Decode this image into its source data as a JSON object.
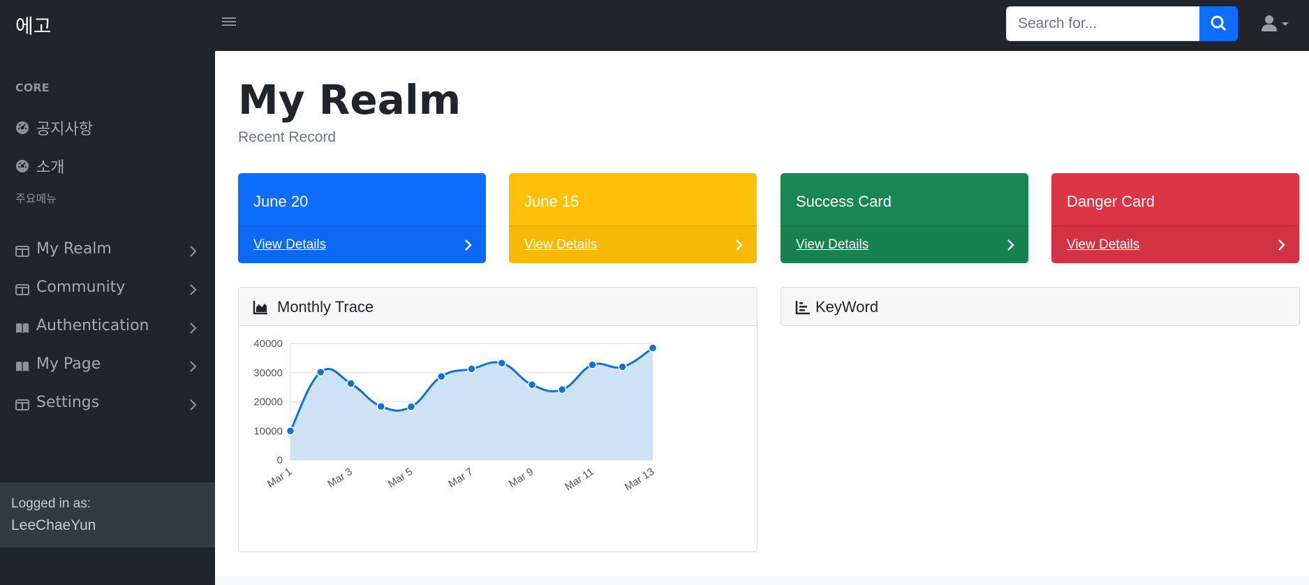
{
  "topnav": {
    "brand": "에고",
    "search_placeholder": "Search for...",
    "icons": {
      "menu": "hamburger-icon",
      "search": "search-icon",
      "user": "user-icon"
    }
  },
  "sidebar": {
    "heading_core": "CORE",
    "core_items": [
      {
        "label": "공지사항",
        "icon": "dashboard-icon"
      },
      {
        "label": "소개",
        "icon": "dashboard-icon"
      }
    ],
    "heading_main": "주요메뉴",
    "main_items": [
      {
        "label": "My Realm",
        "icon": "columns-icon"
      },
      {
        "label": "Community",
        "icon": "columns-icon"
      },
      {
        "label": "Authentication",
        "icon": "book-icon"
      },
      {
        "label": "My Page",
        "icon": "book-icon"
      },
      {
        "label": "Settings",
        "icon": "columns-icon"
      }
    ],
    "footer": {
      "label": "Logged in as:",
      "user": "LeeChaeYun"
    }
  },
  "main": {
    "title": "My Realm",
    "subtitle": "Recent Record",
    "cards": [
      {
        "title": "June 20",
        "link": "View Details",
        "color": "#0d6efd"
      },
      {
        "title": "June 15",
        "link": "View Details",
        "color": "#ffc107"
      },
      {
        "title": "Success Card",
        "link": "View Details",
        "color": "#198754"
      },
      {
        "title": "Danger Card",
        "link": "View Details",
        "color": "#dc3545"
      }
    ],
    "panels": {
      "monthly": {
        "title": "Monthly Trace",
        "icon": "area-chart-icon"
      },
      "keyword": {
        "title": "KeyWord",
        "icon": "bar-chart-icon"
      }
    }
  },
  "chart_data": {
    "type": "area",
    "x": [
      "Mar 1",
      "Mar 2",
      "Mar 3",
      "Mar 4",
      "Mar 5",
      "Mar 6",
      "Mar 7",
      "Mar 8",
      "Mar 9",
      "Mar 10",
      "Mar 11",
      "Mar 12",
      "Mar 13"
    ],
    "x_tick_labels": [
      "Mar 1",
      "Mar 3",
      "Mar 5",
      "Mar 7",
      "Mar 9",
      "Mar 11",
      "Mar 13"
    ],
    "series": [
      {
        "values": [
          10000,
          30162,
          26263,
          18394,
          18287,
          28682,
          31274,
          33259,
          25849,
          24159,
          32651,
          31984,
          38451
        ]
      }
    ],
    "ylim": [
      0,
      40000
    ],
    "y_ticks": [
      0,
      10000,
      20000,
      30000,
      40000
    ],
    "grid": true,
    "colors": {
      "line": "#0d72d1",
      "fill": "#cbe0f5",
      "point": "#0d72d1"
    }
  }
}
